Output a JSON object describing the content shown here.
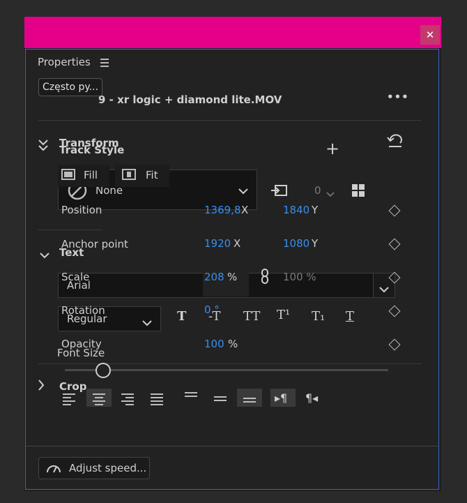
{
  "window": {
    "close_glyph": "✕"
  },
  "panel": {
    "title": "Properties",
    "menu_icon": "hamburger-icon"
  },
  "clip": {
    "name": "9 - xr logic + diamond lite.MOV",
    "more_glyph": "•••"
  },
  "tooltip": {
    "text": "Często py..."
  },
  "transform": {
    "section": "Transform",
    "track_style": "Track Style",
    "fill_label": "Fill",
    "fit_label": "Fit",
    "style_value": "None",
    "stroke_value": "0"
  },
  "properties": {
    "position": {
      "label": "Position",
      "x": "1369,8",
      "x_unit": "X",
      "y": "1840",
      "y_unit": "Y"
    },
    "anchor": {
      "label": "Anchor point",
      "x": "1920",
      "x_unit": "X",
      "y": "1080",
      "y_unit": "Y"
    },
    "scale": {
      "label": "Scale",
      "value": "208",
      "unit": "%",
      "linked_value": "100 %"
    },
    "rotation": {
      "label": "Rotation",
      "value": "0 °"
    },
    "opacity": {
      "label": "Opacity",
      "value": "100",
      "unit": "%"
    }
  },
  "text": {
    "section": "Text",
    "font": "Arial",
    "font_style": "Regular",
    "font_size_label": "Font Size"
  },
  "crop": {
    "section": "Crop"
  },
  "footer": {
    "adjust_speed": "Adjust speed..."
  }
}
